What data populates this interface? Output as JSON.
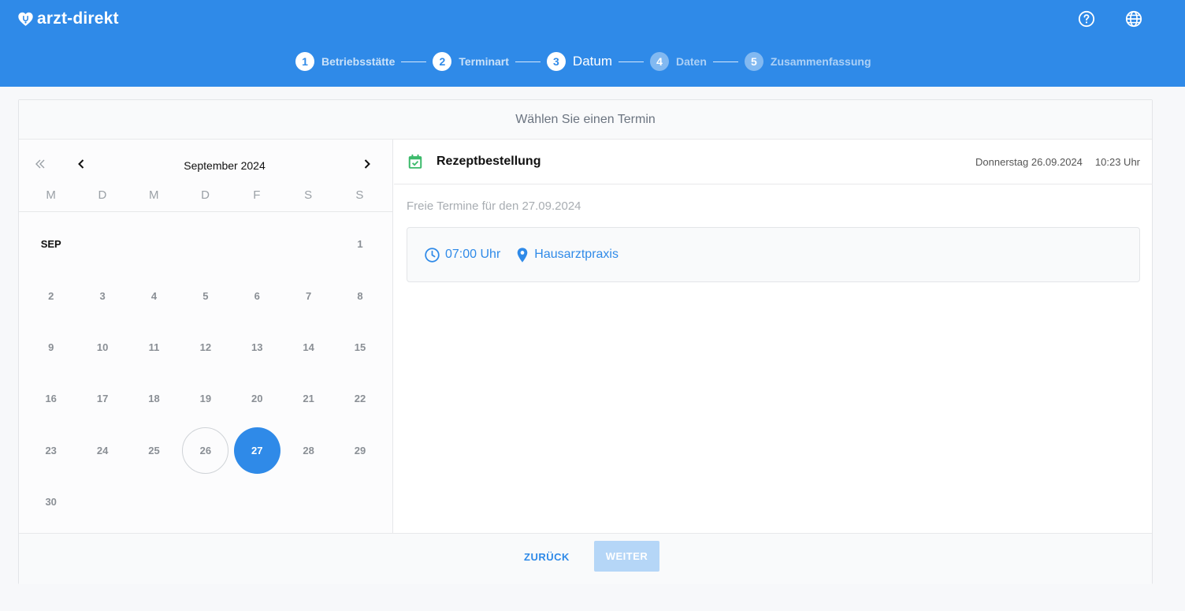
{
  "header": {
    "brand": "arzt-direkt",
    "steps": [
      {
        "num": "1",
        "label": "Betriebsstätte"
      },
      {
        "num": "2",
        "label": "Terminart"
      },
      {
        "num": "3",
        "label": "Datum"
      },
      {
        "num": "4",
        "label": "Daten"
      },
      {
        "num": "5",
        "label": "Zusammenfassung"
      }
    ],
    "current_step": 3
  },
  "card": {
    "title": "Wählen Sie einen Termin"
  },
  "calendar": {
    "month_label": "September 2024",
    "month_tag": "SEP",
    "weekdays": [
      "M",
      "D",
      "M",
      "D",
      "F",
      "S",
      "S"
    ],
    "weeks": [
      [
        "",
        "",
        "",
        "",
        "",
        "",
        "1"
      ],
      [
        "2",
        "3",
        "4",
        "5",
        "6",
        "7",
        "8"
      ],
      [
        "9",
        "10",
        "11",
        "12",
        "13",
        "14",
        "15"
      ],
      [
        "16",
        "17",
        "18",
        "19",
        "20",
        "21",
        "22"
      ],
      [
        "23",
        "24",
        "25",
        "26",
        "27",
        "28",
        "29"
      ],
      [
        "30",
        "",
        "",
        "",
        "",
        "",
        ""
      ]
    ],
    "today": "26",
    "selected": "27"
  },
  "detail": {
    "title": "Rezeptbestellung",
    "date": "Donnerstag 26.09.2024",
    "time": "10:23 Uhr",
    "free_label": "Freie Termine für den 27.09.2024",
    "slot_time": "07:00 Uhr",
    "slot_location": "Hausarztpraxis"
  },
  "footer": {
    "back_label": "ZURÜCK",
    "next_label": "WEITER"
  },
  "colors": {
    "primary": "#2f8ae8",
    "accent_green": "#3cba6b",
    "disabled_button": "#b5d6f7"
  },
  "icons": {
    "logo": "heart-stethoscope-icon",
    "help": "help-circle-icon",
    "language": "globe-icon",
    "first_page": "double-chevron-left-icon",
    "prev": "chevron-left-icon",
    "next": "chevron-right-icon",
    "calendar": "calendar-check-icon",
    "clock": "clock-icon",
    "location": "map-pin-icon"
  }
}
